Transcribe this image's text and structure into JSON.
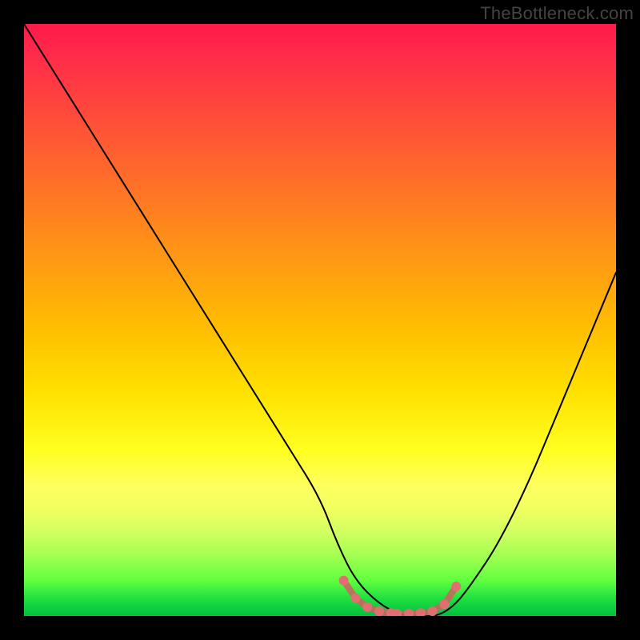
{
  "watermark": "TheBottleneck.com",
  "chart_data": {
    "type": "line",
    "title": "",
    "xlabel": "",
    "ylabel": "",
    "xlim": [
      0,
      100
    ],
    "ylim": [
      0,
      100
    ],
    "grid": false,
    "legend": false,
    "background_gradient": {
      "top": "#ff1a4a",
      "mid_upper": "#ff8020",
      "mid": "#ffe000",
      "mid_lower": "#d0ff60",
      "bottom": "#00c040"
    },
    "series": [
      {
        "name": "bottleneck-curve",
        "stroke": "#000000",
        "stroke_width": 2,
        "x": [
          0,
          5,
          10,
          15,
          20,
          25,
          30,
          35,
          40,
          45,
          50,
          53,
          56,
          60,
          64,
          67,
          70,
          73,
          76,
          80,
          85,
          90,
          95,
          100
        ],
        "y": [
          100,
          92,
          84,
          76,
          68,
          60,
          52,
          44,
          36,
          28,
          20,
          12,
          6,
          2,
          0,
          0,
          0,
          2,
          6,
          12,
          22,
          34,
          46,
          58
        ]
      }
    ],
    "marker": {
      "name": "optimal-range",
      "color": "#e07070",
      "stroke": "#d06060",
      "x": [
        54,
        56,
        58,
        60,
        62,
        63,
        65,
        67,
        69,
        71,
        73
      ],
      "y": [
        6,
        3,
        1.5,
        0.8,
        0.5,
        0.4,
        0.4,
        0.5,
        0.8,
        2,
        5
      ]
    }
  }
}
